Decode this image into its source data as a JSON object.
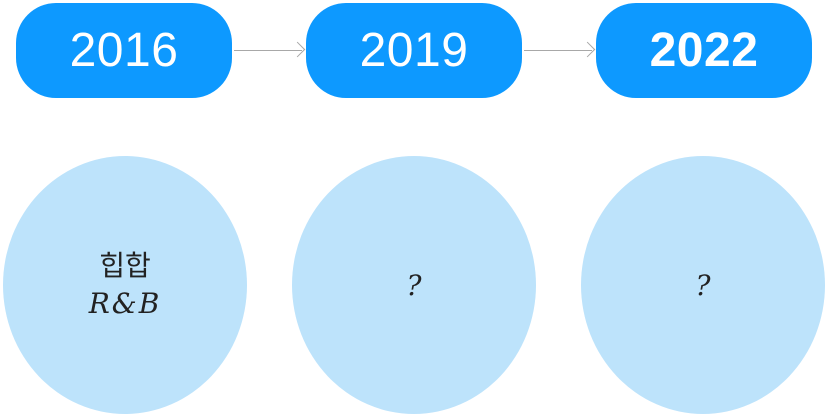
{
  "timeline": {
    "years": [
      "2016",
      "2019",
      "2022"
    ]
  },
  "genres": {
    "first_line1": "힙합",
    "first_line2": "R&B",
    "second": "?",
    "third": "?"
  },
  "colors": {
    "pill": "#0d99ff",
    "circle": "#bde3fb",
    "arrow": "#a8a8a8"
  }
}
